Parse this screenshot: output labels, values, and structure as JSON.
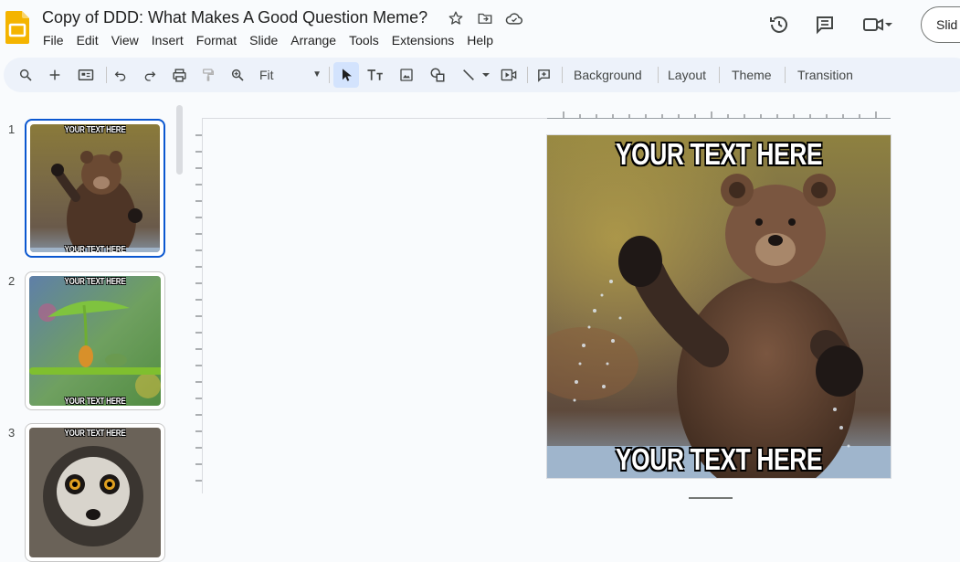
{
  "app": {
    "doc_title": "Copy of DDD: What Makes A Good Question Meme?",
    "menu": [
      "File",
      "Edit",
      "View",
      "Insert",
      "Format",
      "Slide",
      "Arrange",
      "Tools",
      "Extensions",
      "Help"
    ],
    "slideshow_label": "Slid"
  },
  "toolbar": {
    "zoom_value": "Fit",
    "background_label": "Background",
    "layout_label": "Layout",
    "theme_label": "Theme",
    "transition_label": "Transition"
  },
  "slides": [
    {
      "number": "1",
      "top_text": "YOUR TEXT HERE",
      "bottom_text": "YOUR TEXT HERE",
      "image": "bear-waving"
    },
    {
      "number": "2",
      "top_text": "YOUR TEXT HERE",
      "bottom_text": "YOUR TEXT HERE",
      "image": "frog-leaf-umbrella"
    },
    {
      "number": "3",
      "top_text": "YOUR TEXT HERE",
      "bottom_text": "",
      "image": "lemur-surprised"
    }
  ],
  "current_slide": {
    "top_text": "YOUR TEXT HERE",
    "bottom_text": "YOUR TEXT HERE"
  },
  "colors": {
    "accent": "#0b57d0",
    "toolbar_bg": "#edf2fa",
    "app_logo": "#f4b400"
  }
}
